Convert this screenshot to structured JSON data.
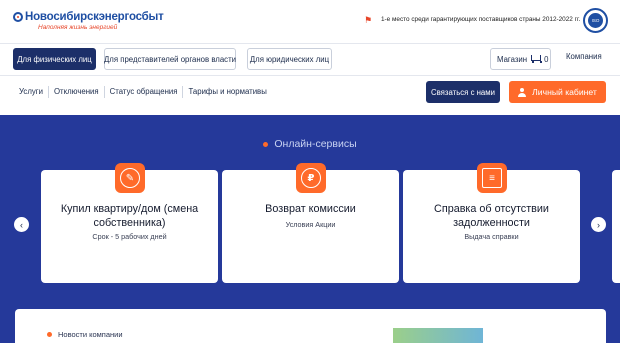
{
  "brand": {
    "title": "Новосибирскэнергосбыт",
    "slogan": "Наполняя жизнь энергией",
    "logo_icon": "lightbulb-logo-icon"
  },
  "award": {
    "icon": "flag-icon",
    "text": "1-е место среди гарантирующих поставщиков страны 2012-2022 гг.",
    "seal_text": "ISO"
  },
  "segments": [
    {
      "label": "Для физических лиц",
      "active": true
    },
    {
      "label": "Для представителей органов власти",
      "active": false
    },
    {
      "label": "Для юридических лиц",
      "active": false
    }
  ],
  "shop": {
    "label": "Магазин",
    "cart_count": "0",
    "icon": "cart-icon"
  },
  "company_link": "Компания",
  "subnav": [
    "Услуги",
    "Отключения",
    "Статус обращения",
    "Тарифы и нормативы"
  ],
  "buttons": {
    "contact": "Связаться с нами",
    "cabinet": "Личный кабинет"
  },
  "services": {
    "title": "Онлайн-сервисы",
    "cards": [
      {
        "title": "Купил квартиру/дом (смена собственника)",
        "sub": "Срок - 5 рабочих дней",
        "icon": "document-edit-icon"
      },
      {
        "title": "Возврат комиссии",
        "sub": "Условия Акции",
        "icon": "ruble-icon"
      },
      {
        "title": "Справка об отсутствии задолженности",
        "sub": "Выдача справки",
        "icon": "certificate-icon"
      }
    ]
  },
  "news": {
    "title": "Новости компании"
  },
  "colors": {
    "navy": "#1c2f69",
    "hero_blue": "#25399a",
    "accent_orange": "#ff6a2a"
  }
}
